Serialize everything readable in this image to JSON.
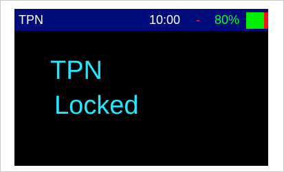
{
  "status_bar": {
    "title": "TPN",
    "time": "10:00",
    "separator": "-",
    "battery_percent_label": "80%",
    "battery_level": 0.8,
    "colors": {
      "bar_background": "#000c7a",
      "title": "#ffffff",
      "separator": "#ff2020",
      "percent": "#00ff2a",
      "battery_full": "#00f000",
      "battery_empty": "#ff1010"
    }
  },
  "main": {
    "line1": "TPN",
    "line2": "Locked",
    "text_color": "#20e8ff",
    "background": "#000000"
  }
}
